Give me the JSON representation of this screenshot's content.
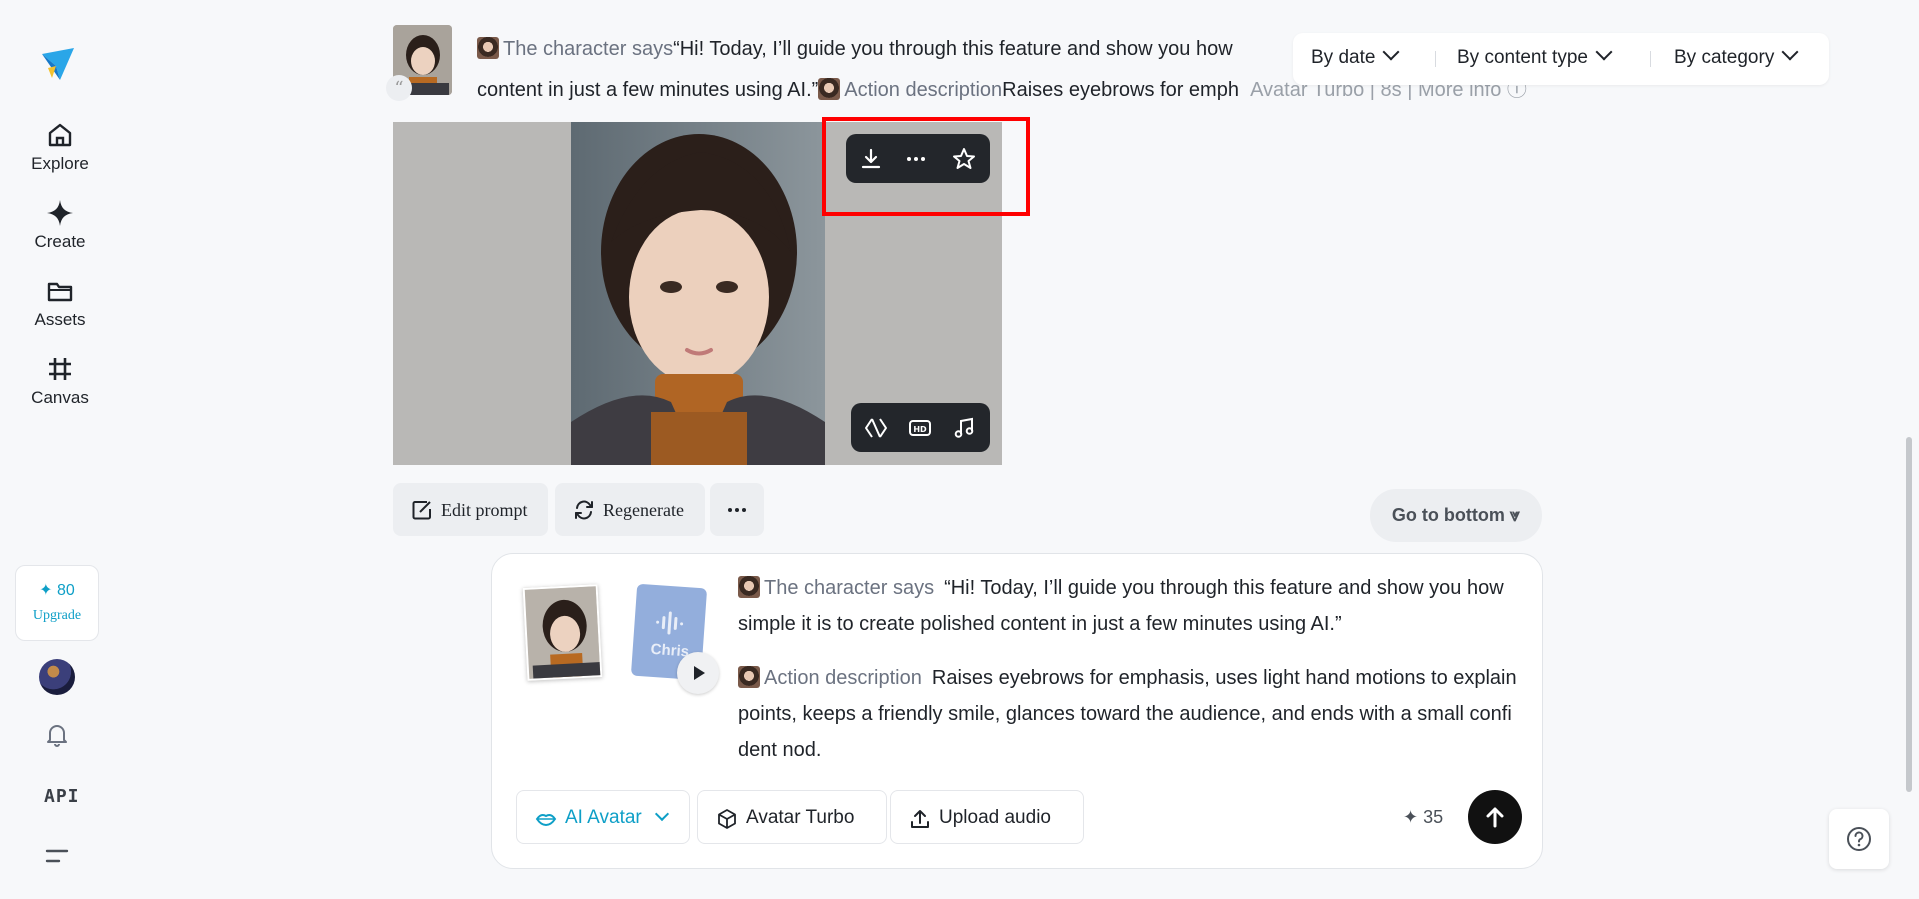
{
  "sidebar": {
    "items": [
      {
        "label": "Explore",
        "icon": "home-icon"
      },
      {
        "label": "Create",
        "icon": "sparkle-icon"
      },
      {
        "label": "Assets",
        "icon": "folder-icon"
      },
      {
        "label": "Canvas",
        "icon": "grid-crop-icon"
      }
    ],
    "credits": "✦ 80",
    "upgrade_label": "Upgrade",
    "api_label": "API"
  },
  "message": {
    "character_says_tag": "The character says",
    "character_says_text": "“Hi! Today, I’ll guide you through this feature and show you how",
    "line2_start": "content in just a few minutes using AI.”",
    "action_tag": "Action description",
    "action_text": "Raises eyebrows for emph",
    "model": "Avatar Turbo",
    "duration": "8s",
    "more_info": "More info"
  },
  "filters": {
    "by_date": "By date",
    "by_content_type": "By content type",
    "by_category": "By category"
  },
  "actions": {
    "edit_prompt": "Edit prompt",
    "regenerate": "Regenerate",
    "go_to_bottom": "Go to bottom"
  },
  "composer": {
    "audio_name": "Chris",
    "character_says_tag": "The character says",
    "character_says_text": "“Hi! Today, I’ll guide you through this feature and show you how simple it is to create polished content in just a few minutes using AI.”",
    "action_tag": "Action description",
    "action_text": "Raises eyebrows for emphasis, uses light hand motions to explain points, keeps a friendly smile, glances toward the audience, and ends with a small confident nod.",
    "mode_label": "AI Avatar",
    "model_label": "Avatar Turbo",
    "upload_label": "Upload audio",
    "cost": "35",
    "accent_color": "#0e9fc7"
  }
}
